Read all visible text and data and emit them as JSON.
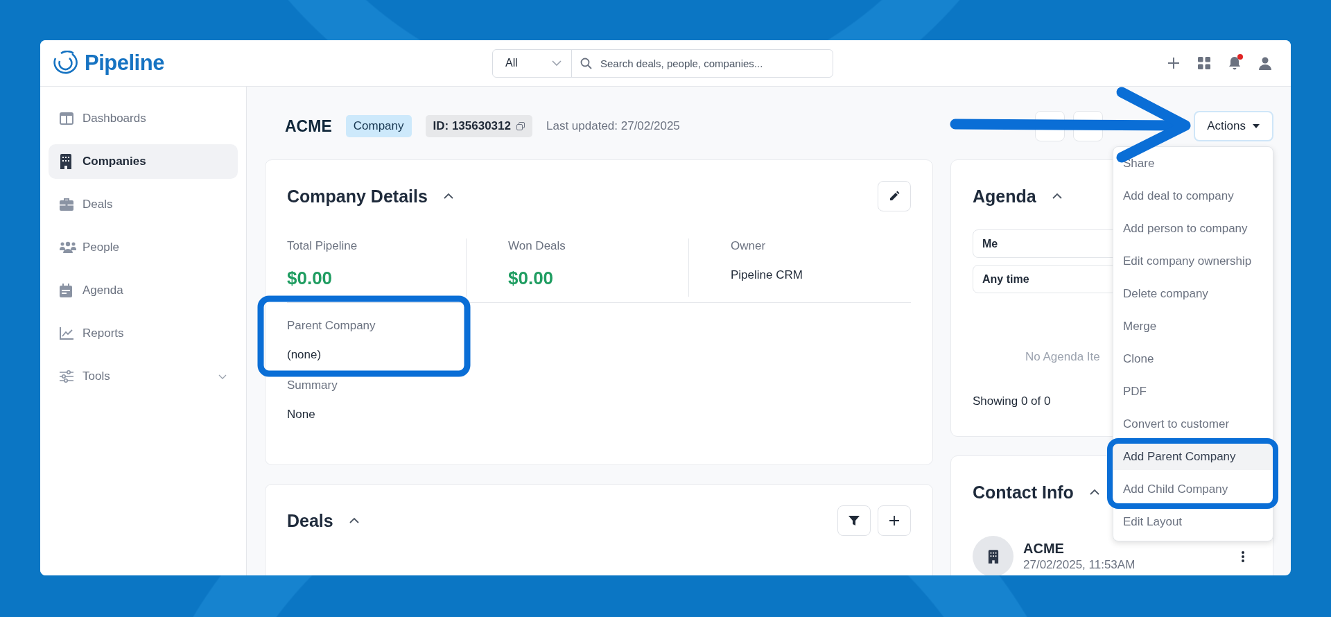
{
  "header": {
    "logo": "Pipeline",
    "search_scope": "All",
    "search_placeholder": "Search deals, people, companies...",
    "unread_notifications": true
  },
  "sidebar": {
    "items": [
      {
        "label": "Dashboards",
        "selected": false
      },
      {
        "label": "Companies",
        "selected": true
      },
      {
        "label": "Deals",
        "selected": false
      },
      {
        "label": "People",
        "selected": false
      },
      {
        "label": "Agenda",
        "selected": false
      },
      {
        "label": "Reports",
        "selected": false
      },
      {
        "label": "Tools",
        "selected": false,
        "expanded": false
      }
    ]
  },
  "record": {
    "name": "ACME",
    "type_badge": "Company",
    "id_badge": "ID: 135630312",
    "last_updated": "Last updated: 27/02/2025",
    "actions_button": "Actions"
  },
  "actions_menu": {
    "items": [
      {
        "label": "Share",
        "selected": false
      },
      {
        "label": "Add deal to company",
        "selected": false
      },
      {
        "label": "Add person to company",
        "selected": false
      },
      {
        "label": "Edit company ownership",
        "selected": false
      },
      {
        "label": "Delete company",
        "selected": false
      },
      {
        "label": "Merge",
        "selected": false
      },
      {
        "label": "Clone",
        "selected": false
      },
      {
        "label": "PDF",
        "selected": false
      },
      {
        "label": "Convert to customer",
        "selected": false
      },
      {
        "label": "Add Parent Company",
        "selected": true
      },
      {
        "label": "Add Child Company",
        "selected": false
      },
      {
        "label": "Edit Layout",
        "selected": false
      }
    ]
  },
  "company_details": {
    "title": "Company Details",
    "expanded": true,
    "stats": [
      {
        "label": "Total Pipeline",
        "value": "$0.00",
        "kind": "money"
      },
      {
        "label": "Won Deals",
        "value": "$0.00",
        "kind": "money"
      },
      {
        "label": "Owner",
        "value": "Pipeline CRM",
        "kind": "text"
      }
    ],
    "fields": [
      {
        "label": "Parent Company",
        "value": "(none)"
      },
      {
        "label": "Summary",
        "value": "None"
      }
    ]
  },
  "deals": {
    "title": "Deals",
    "expanded": true
  },
  "agenda": {
    "title": "Agenda",
    "expanded": true,
    "filters": [
      "Me",
      "Any time"
    ],
    "empty_text": "No Agenda Ite",
    "footer": "Showing 0 of 0"
  },
  "contact_info": {
    "title": "Contact Info",
    "expanded": true,
    "contacts": [
      {
        "name": "ACME",
        "timestamp": "27/02/2025, 11:53AM"
      }
    ]
  }
}
